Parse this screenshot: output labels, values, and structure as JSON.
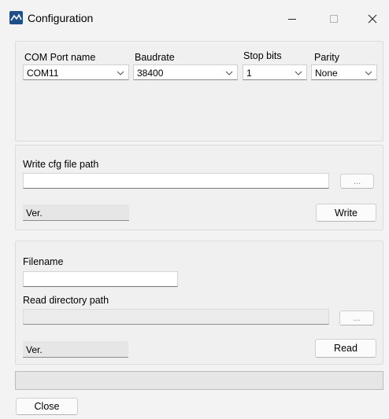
{
  "window": {
    "title": "Configuration",
    "icon": "app-logo-icon",
    "controls": [
      "minimize-icon",
      "maximize-icon",
      "close-icon"
    ]
  },
  "com_settings": {
    "port_label": "COM Port name",
    "port_value": "COM11",
    "baud_label": "Baudrate",
    "baud_value": "38400",
    "stopbits_label": "Stop bits",
    "stopbits_value": "1",
    "parity_label": "Parity",
    "parity_value": "None"
  },
  "write_section": {
    "path_label": "Write cfg file path",
    "path_value": "",
    "browse_label": "...",
    "version_label": "Ver.",
    "write_label": "Write"
  },
  "read_section": {
    "filename_label": "Filename",
    "filename_value": "",
    "dir_label": "Read directory path",
    "dir_value": "",
    "browse_label": "...",
    "version_label": "Ver.",
    "read_label": "Read"
  },
  "progress": {
    "value": 0
  },
  "footer": {
    "close_label": "Close"
  }
}
